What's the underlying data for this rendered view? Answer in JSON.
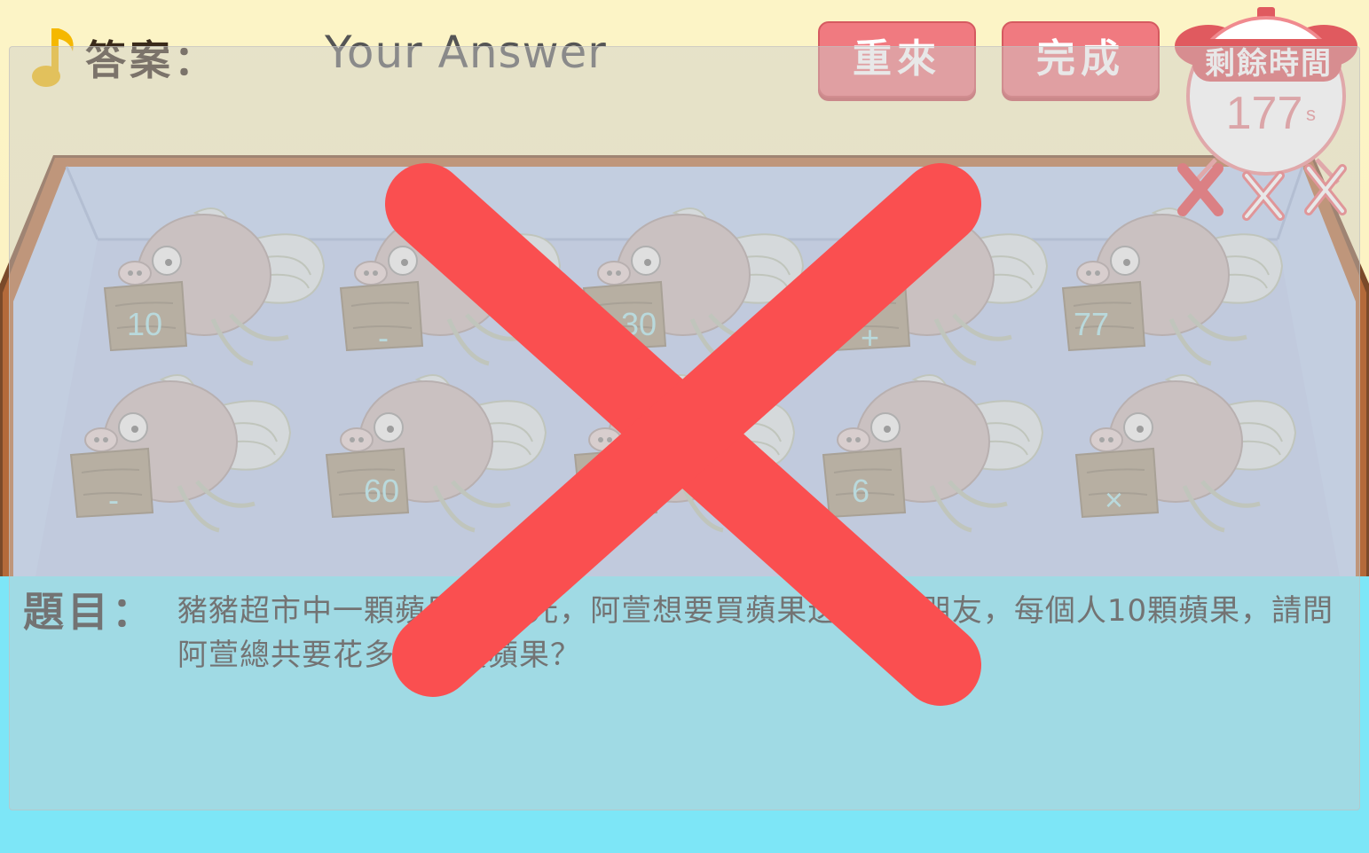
{
  "header": {
    "answer_label": "答案：",
    "answer_value": "Your Answer",
    "restart_label": "重來",
    "done_label": "完成"
  },
  "timer": {
    "title": "剩餘時間",
    "value": "177",
    "unit": "s"
  },
  "strikes": {
    "count": 3
  },
  "fish_tiles": [
    {
      "label": "10"
    },
    {
      "label": "-"
    },
    {
      "label": "30"
    },
    {
      "label": "+"
    },
    {
      "label": "77"
    },
    {
      "label": "-"
    },
    {
      "label": "60"
    },
    {
      "label": ""
    },
    {
      "label": "6"
    },
    {
      "label": "×"
    }
  ],
  "question": {
    "label": "題目：",
    "text": "豬豬超市中一顆蘋果賣30元，阿萱想要買蘋果送給6個朋友，每個人10顆蘋果，請問阿萱總共要花多少錢買蘋果？"
  },
  "colors": {
    "button": "#f07a80",
    "wrong_mark": "#fa4f50",
    "tank_water": "#b5c5e8",
    "bottom_water": "#7de6f7"
  }
}
